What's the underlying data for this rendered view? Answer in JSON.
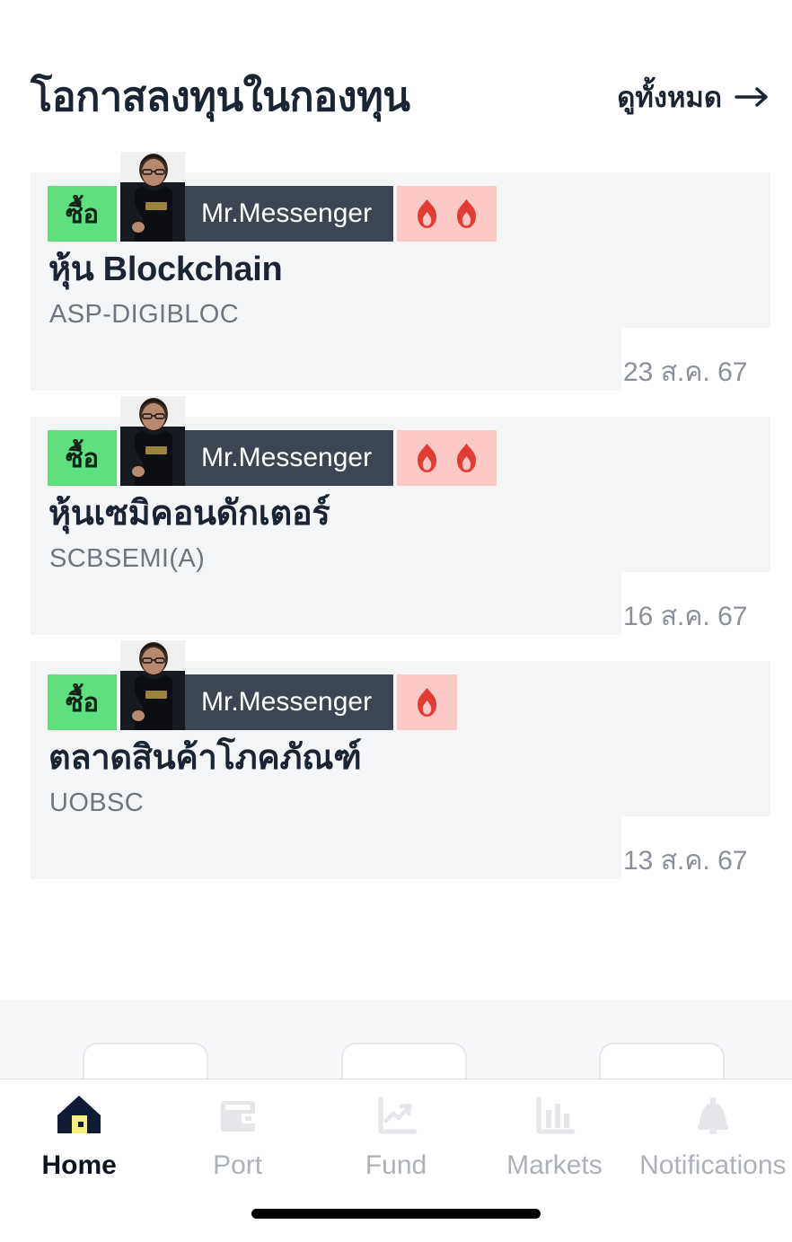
{
  "header": {
    "title": "โอกาสลงทุนในกองทุน",
    "see_all_label": "ดูทั้งหมด",
    "see_all_icon": "arrow-right-icon"
  },
  "theme": {
    "accent_green": "#5fe07f",
    "author_chip": "#3c4653",
    "heat_chip": "#fbc9c6",
    "flame_color": "#e23b33",
    "card_bg": "#f4f5f7",
    "text_primary": "#1b2432",
    "text_muted": "#6f7680",
    "date_color": "#8b9099",
    "nav_inactive": "#adb1b8",
    "nav_active": "#0d1420",
    "home_icon_body": "#0d1b34",
    "home_icon_door": "#f4f07a"
  },
  "cards": [
    {
      "action_label": "ซื้อ",
      "author": "Mr.Messenger",
      "avatar_icon": "avatar-photo",
      "heat_count": 2,
      "heat_icon": "flame-icon",
      "title": "หุ้น Blockchain",
      "fund_code": "ASP-DIGIBLOC",
      "date": "23 ส.ค. 67"
    },
    {
      "action_label": "ซื้อ",
      "author": "Mr.Messenger",
      "avatar_icon": "avatar-photo",
      "heat_count": 2,
      "heat_icon": "flame-icon",
      "title": "หุ้นเซมิคอนดักเตอร์",
      "fund_code": "SCBSEMI(A)",
      "date": "16 ส.ค. 67"
    },
    {
      "action_label": "ซื้อ",
      "author": "Mr.Messenger",
      "avatar_icon": "avatar-photo",
      "heat_count": 1,
      "heat_icon": "flame-icon",
      "title": "ตลาดสินค้าโภคภัณฑ์",
      "fund_code": "UOBSC",
      "date": "13 ส.ค. 67"
    }
  ],
  "bottom_nav": {
    "items": [
      {
        "label": "Home",
        "icon": "home-icon",
        "active": true
      },
      {
        "label": "Port",
        "icon": "wallet-icon",
        "active": false
      },
      {
        "label": "Fund",
        "icon": "trend-chart-icon",
        "active": false
      },
      {
        "label": "Markets",
        "icon": "bar-chart-icon",
        "active": false
      },
      {
        "label": "Notifications",
        "icon": "bell-icon",
        "active": false
      }
    ]
  }
}
